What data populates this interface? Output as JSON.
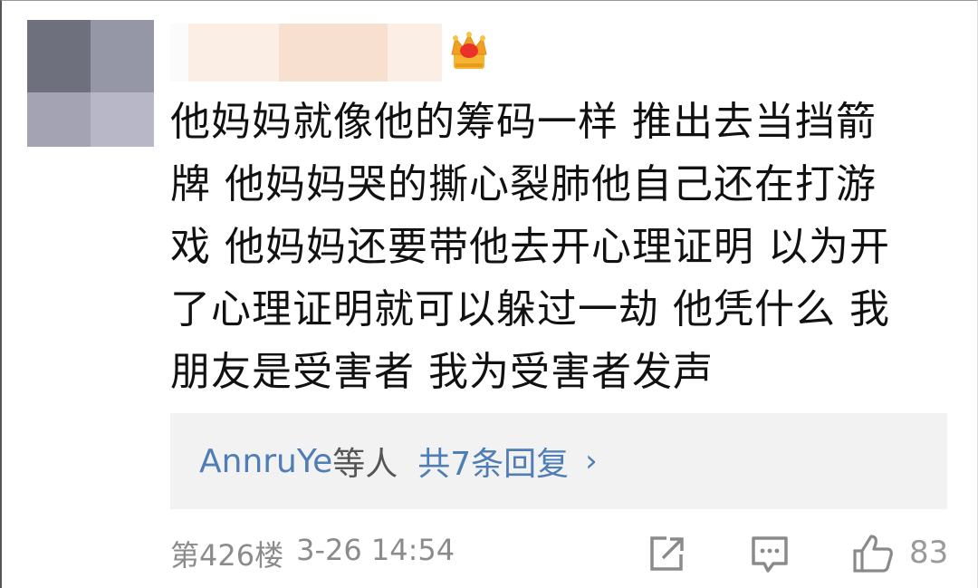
{
  "comment": {
    "text_lines": [
      "他妈妈就像他的筹码一样 推出去当挡箭",
      "牌 他妈妈哭的撕心裂肺他自己还在打游",
      "戏 他妈妈还要带他去开心理证明 以为开",
      "了心理证明就可以躲过一劫 他凭什么 我",
      "朋友是受害者 我为受害者发声"
    ]
  },
  "replies": {
    "user": "AnnruYe",
    "suffix": "等人",
    "count_label": "共7条回复",
    "chevron": "›"
  },
  "meta": {
    "floor": "第426楼",
    "datetime": "3-26 14:54"
  },
  "actions": {
    "like_count": "83"
  },
  "colors": {
    "link_blue": "#4f7db6",
    "reply_bg": "#f2f2f2",
    "meta_gray": "#8b8b8b"
  },
  "icons": [
    "crown-icon",
    "share-icon",
    "comment-icon",
    "like-icon"
  ]
}
